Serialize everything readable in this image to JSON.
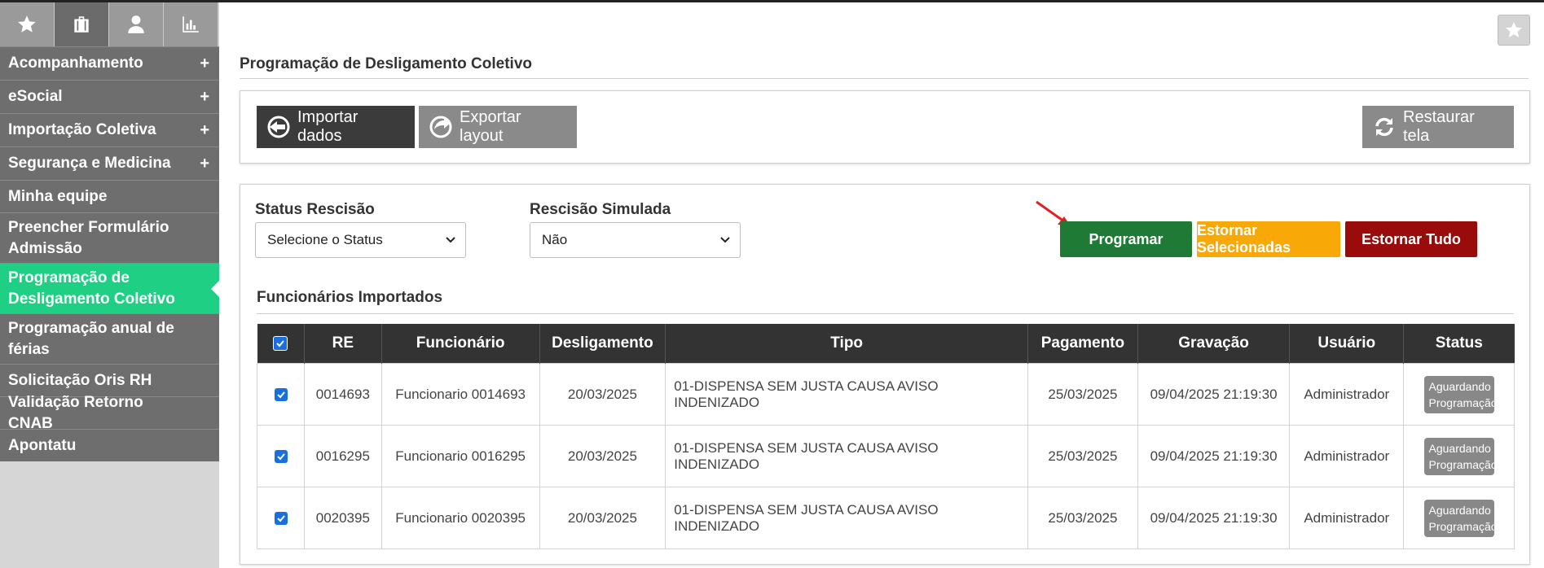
{
  "sidebar": {
    "tabs": [
      {
        "icon": "star-icon"
      },
      {
        "icon": "briefcase-icon"
      },
      {
        "icon": "user-icon"
      },
      {
        "icon": "bar-chart-icon"
      }
    ],
    "items": [
      {
        "label": "Acompanhamento",
        "expandable": "+"
      },
      {
        "label": "eSocial",
        "expandable": "+"
      },
      {
        "label": "Importação Coletiva",
        "expandable": "+"
      },
      {
        "label": "Segurança e Medicina",
        "expandable": "+"
      },
      {
        "label": "Minha equipe"
      },
      {
        "label": "Preencher Formulário Admissão"
      },
      {
        "label": "Programação de Desligamento Coletivo"
      },
      {
        "label": "Programação anual de férias"
      },
      {
        "label": "Solicitação Oris RH"
      },
      {
        "label": "Validação Retorno CNAB"
      },
      {
        "label": "Apontatu"
      }
    ]
  },
  "header": {
    "title": "Programação de Desligamento Coletivo"
  },
  "toolbar": {
    "import_label": "Importar dados",
    "export_label": "Exportar layout",
    "restore_label": "Restaurar tela"
  },
  "filters": {
    "status_label": "Status Rescisão",
    "status_value": "Selecione o Status",
    "simulada_label": "Rescisão Simulada",
    "simulada_value": "Não"
  },
  "actions": {
    "programar": "Programar",
    "estornar_sel": "Estornar Selecionadas",
    "estornar_tudo": "Estornar Tudo"
  },
  "section": {
    "title": "Funcionários Importados"
  },
  "table": {
    "columns": [
      "RE",
      "Funcionário",
      "Desligamento",
      "Tipo",
      "Pagamento",
      "Gravação",
      "Usuário",
      "Status"
    ],
    "rows": [
      {
        "re": "0014693",
        "funcionario": "Funcionario 0014693",
        "desligamento": "20/03/2025",
        "tipo": "01-DISPENSA SEM JUSTA CAUSA AVISO INDENIZADO",
        "pagamento": "25/03/2025",
        "gravacao": "09/04/2025 21:19:30",
        "usuario": "Administrador",
        "status": "Aguardando Programação"
      },
      {
        "re": "0016295",
        "funcionario": "Funcionario 0016295",
        "desligamento": "20/03/2025",
        "tipo": "01-DISPENSA SEM JUSTA CAUSA AVISO INDENIZADO",
        "pagamento": "25/03/2025",
        "gravacao": "09/04/2025 21:19:30",
        "usuario": "Administrador",
        "status": "Aguardando Programação"
      },
      {
        "re": "0020395",
        "funcionario": "Funcionario 0020395",
        "desligamento": "20/03/2025",
        "tipo": "01-DISPENSA SEM JUSTA CAUSA AVISO INDENIZADO",
        "pagamento": "25/03/2025",
        "gravacao": "09/04/2025 21:19:30",
        "usuario": "Administrador",
        "status": "Aguardando Programação"
      }
    ]
  },
  "colors": {
    "active_menu": "#1fd084",
    "programar": "#1e7a34",
    "estornar_selecionadas": "#f9a907",
    "estornar_tudo": "#9a0c0c",
    "checkbox": "#1a6fe0"
  }
}
